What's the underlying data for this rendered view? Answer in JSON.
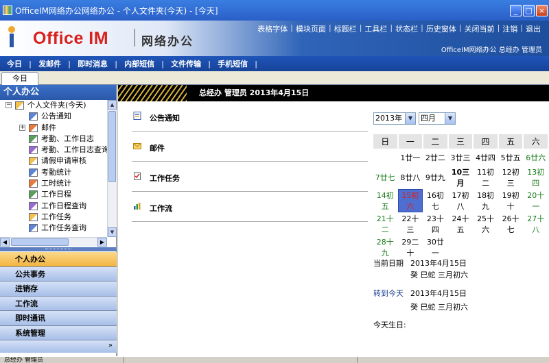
{
  "window": {
    "title": "OfficeIM网络办公网络办公 - 个人文件夹(今天) - [今天]",
    "controls": [
      "_",
      "□",
      "×"
    ]
  },
  "header": {
    "logo": "Office IM",
    "slogan": "网络办公",
    "top_menu": [
      "表格字体",
      "模块页面",
      "标题栏",
      "工具栏",
      "状态栏",
      "历史窗体",
      "关闭当前",
      "注销",
      "退出"
    ],
    "user_line": "OfficeIM网络办公  总经办  管理员"
  },
  "navbar": [
    "今日",
    "发邮件",
    "即时消息",
    "内部短信",
    "文件传输",
    "手机短信"
  ],
  "tabs": {
    "active": "今日"
  },
  "left_pane": {
    "title": "个人办公",
    "tree": [
      {
        "label": "个人文件夹(今天)",
        "level": 0,
        "expander": "−",
        "icon": "folder-user-icon"
      },
      {
        "label": "公告通知",
        "level": 1,
        "icon": "notice-icon"
      },
      {
        "label": "邮件",
        "level": 1,
        "expander": "+",
        "icon": "mail-icon"
      },
      {
        "label": "考勤、工作日志",
        "level": 1,
        "icon": "calendar-grid-icon"
      },
      {
        "label": "考勤、工作日志查询",
        "level": 1,
        "icon": "calendar-search-icon"
      },
      {
        "label": "请假申请审核",
        "level": 1,
        "icon": "approval-icon"
      },
      {
        "label": "考勤统计",
        "level": 1,
        "icon": "stats-icon"
      },
      {
        "label": "工时统计",
        "level": 1,
        "icon": "film-icon"
      },
      {
        "label": "工作日程",
        "level": 1,
        "icon": "schedule-icon"
      },
      {
        "label": "工作日程查询",
        "level": 1,
        "icon": "schedule-search-icon"
      },
      {
        "label": "工作任务",
        "level": 1,
        "icon": "task-icon"
      },
      {
        "label": "工作任务查询",
        "level": 1,
        "icon": "task-search-icon"
      }
    ],
    "accordion": [
      "个人办公",
      "公共事务",
      "进销存",
      "工作流",
      "即时通讯",
      "系统管理"
    ],
    "accordion_active": "个人办公",
    "more": "»"
  },
  "main": {
    "header_text": "总经办  管理员  2013年4月15日",
    "sections": [
      "公告通知",
      "邮件",
      "工作任务",
      "工作流"
    ]
  },
  "calendar": {
    "year": "2013年",
    "month": "四月",
    "weekdays": [
      "日",
      "一",
      "二",
      "三",
      "四",
      "五",
      "六"
    ],
    "weeks": [
      [
        "",
        "1廿一",
        "2廿二",
        "3廿三",
        "4廿四",
        "5廿五",
        "6廿六"
      ],
      [
        "7廿七",
        "8廿八",
        "9廿九",
        "10三月",
        "11初二",
        "12初三",
        "13初四"
      ],
      [
        "14初五",
        "15初六",
        "16初七",
        "17初八",
        "18初九",
        "19初十",
        "20十一"
      ],
      [
        "21十二",
        "22十三",
        "23十四",
        "24十五",
        "25十六",
        "26十七",
        "27十八"
      ],
      [
        "28十九",
        "29二十",
        "30廿一",
        "",
        "",
        "",
        ""
      ]
    ],
    "today": "15初六",
    "holiday": "10三月"
  },
  "date_info": {
    "current_label": "当前日期",
    "current_date": "2013年4月15日",
    "current_lunar": "癸 巳蛇 三月初六",
    "goto_label": "转到今天",
    "goto_date": "2013年4月15日",
    "goto_lunar": "癸 巳蛇 三月初六",
    "birthday_label": "今天生日:"
  },
  "statusbar": {
    "user": "总经办 管理员"
  },
  "colors": {
    "titlebar": "#2a5fc8",
    "navbar": "#1f55b8",
    "logo": "#d8201c",
    "accordion_active": "#f3b33f",
    "today_cell": "#4e6fd1",
    "weekend": "#177a17"
  }
}
